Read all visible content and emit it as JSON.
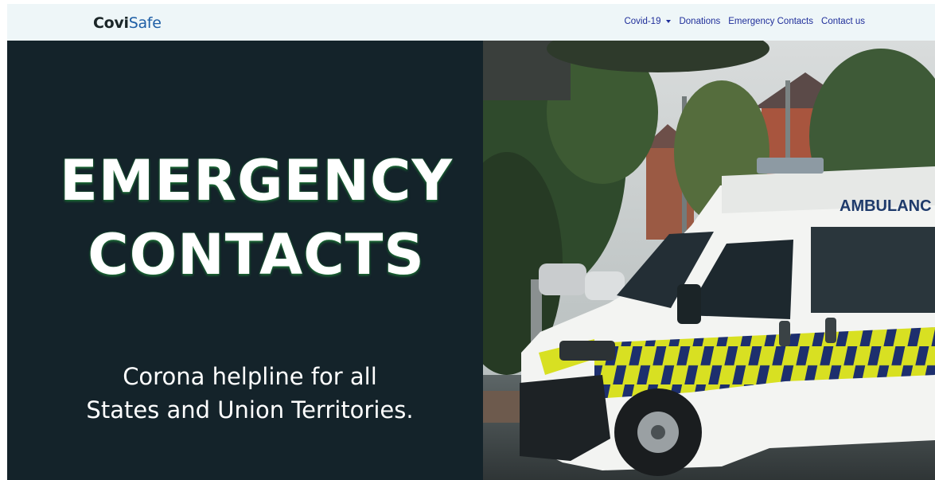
{
  "navbar": {
    "brand_part1": "Covi",
    "brand_part2": "Safe",
    "links": [
      "Covid-19",
      "Donations",
      "Emergency Contacts",
      "Contact us"
    ]
  },
  "hero": {
    "title_line1": "EMERGENCY",
    "title_line2": "CONTACTS",
    "subtitle_line1": "Corona helpline for all",
    "subtitle_line2": "States and Union Territories."
  },
  "photo": {
    "ambulance_text": "AMBULANC"
  },
  "colors": {
    "panel_bg": "#14232a",
    "nav_bg": "#eef6f8",
    "nav_link": "#1f2e9a",
    "title_glow": "#1c6d35"
  }
}
